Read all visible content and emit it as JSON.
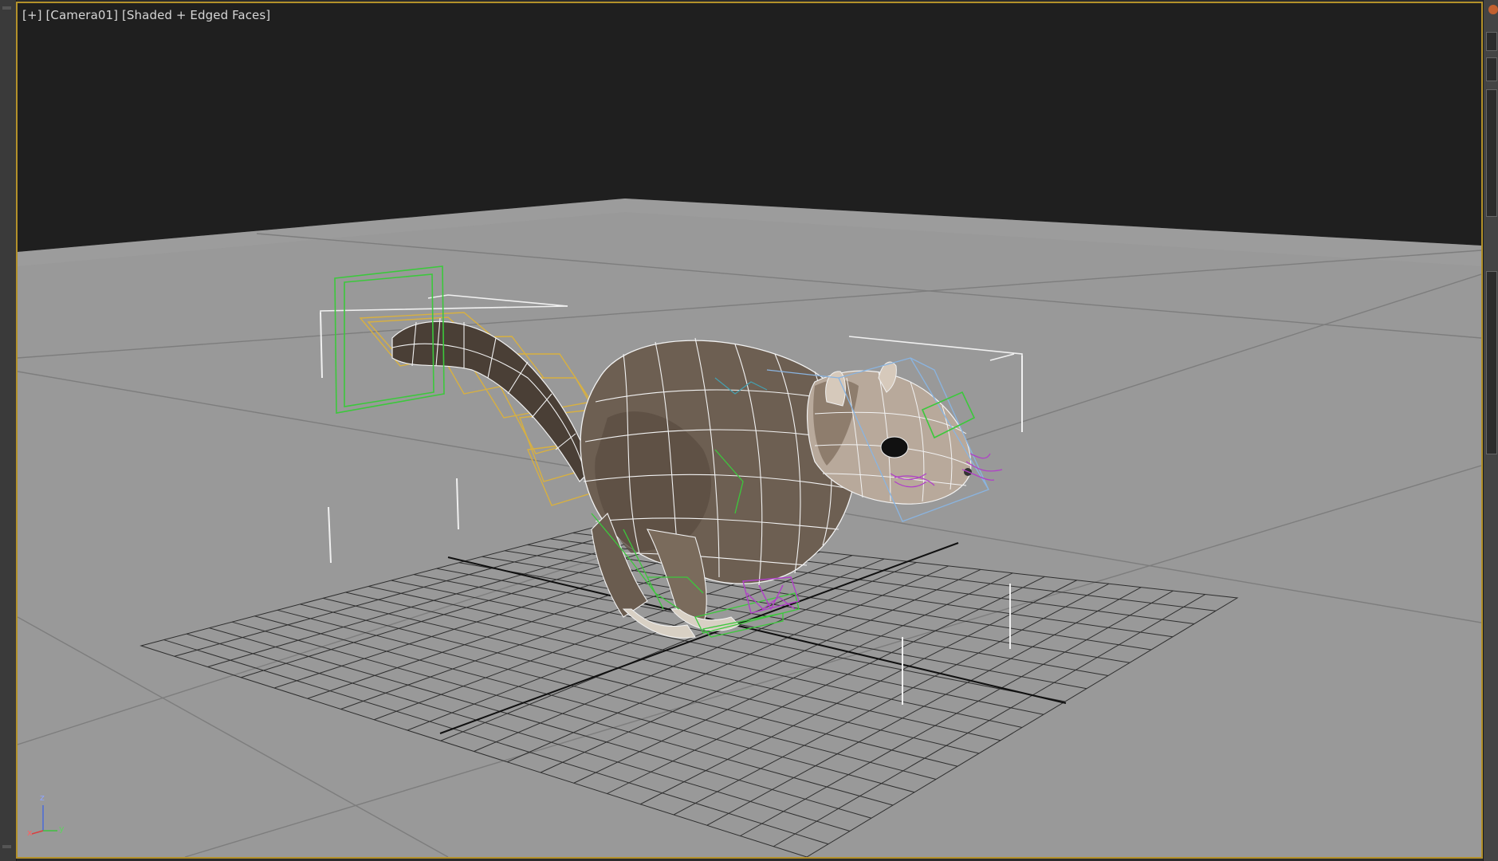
{
  "viewport": {
    "plus_menu": "[+]",
    "camera_menu": "[Camera01]",
    "shading_menu": "[Shaded + Edged Faces]"
  },
  "axis": {
    "z": "z",
    "x": "x",
    "y": "y"
  },
  "colors": {
    "viewport_border": "#b3912a",
    "sky": "#1f1f1f",
    "ground": "#9a9a9a",
    "grid_line": "#2e2e2e",
    "mesh_wire": "#f2f2f2",
    "rig_yellow": "#d8b040",
    "rig_green": "#3cc83c",
    "rig_blue": "#8ab4e0",
    "rig_purple": "#b040c8"
  },
  "icons": [
    "squirrel-model",
    "axis-tripod-icon"
  ]
}
